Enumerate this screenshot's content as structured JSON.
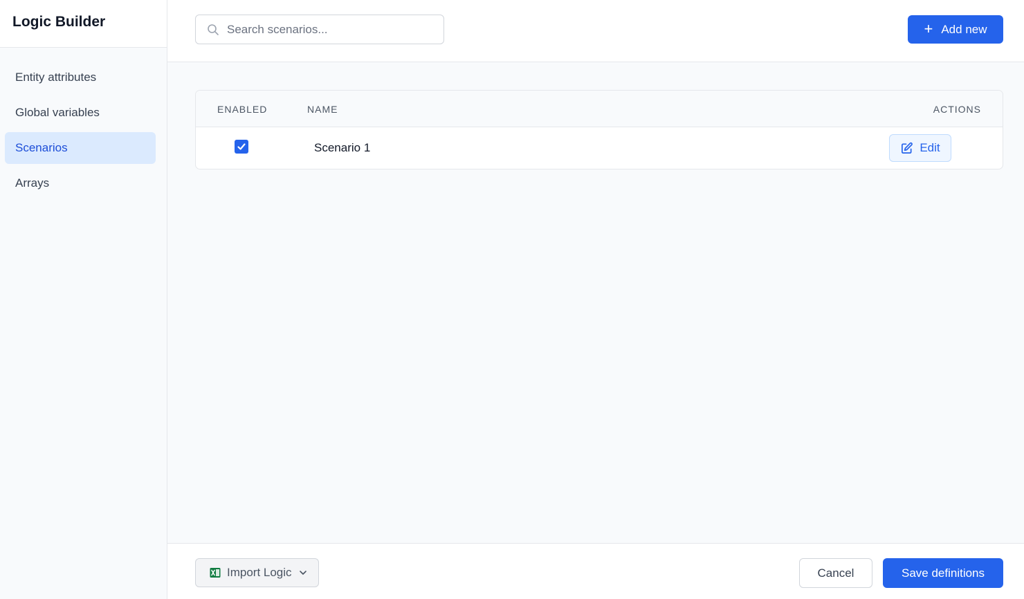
{
  "sidebar": {
    "title": "Logic Builder",
    "items": [
      {
        "label": "Entity attributes",
        "active": false
      },
      {
        "label": "Global variables",
        "active": false
      },
      {
        "label": "Scenarios",
        "active": true
      },
      {
        "label": "Arrays",
        "active": false
      }
    ]
  },
  "toolbar": {
    "search_placeholder": "Search scenarios...",
    "search_value": "",
    "add_label": "Add new",
    "add_icon": "plus-icon"
  },
  "table": {
    "columns": [
      "ENABLED",
      "NAME",
      "ACTIONS"
    ],
    "rows": [
      {
        "enabled": true,
        "name": "Scenario 1",
        "action_label": "Edit",
        "action_icon": "pencil-square-icon"
      }
    ]
  },
  "footer": {
    "import_label": "Import Logic",
    "import_icon": "excel-icon",
    "cancel_label": "Cancel",
    "save_label": "Save definitions"
  },
  "colors": {
    "accent": "#2563eb",
    "active_nav_bg": "#dbeafe",
    "excel_green": "#107c41"
  }
}
